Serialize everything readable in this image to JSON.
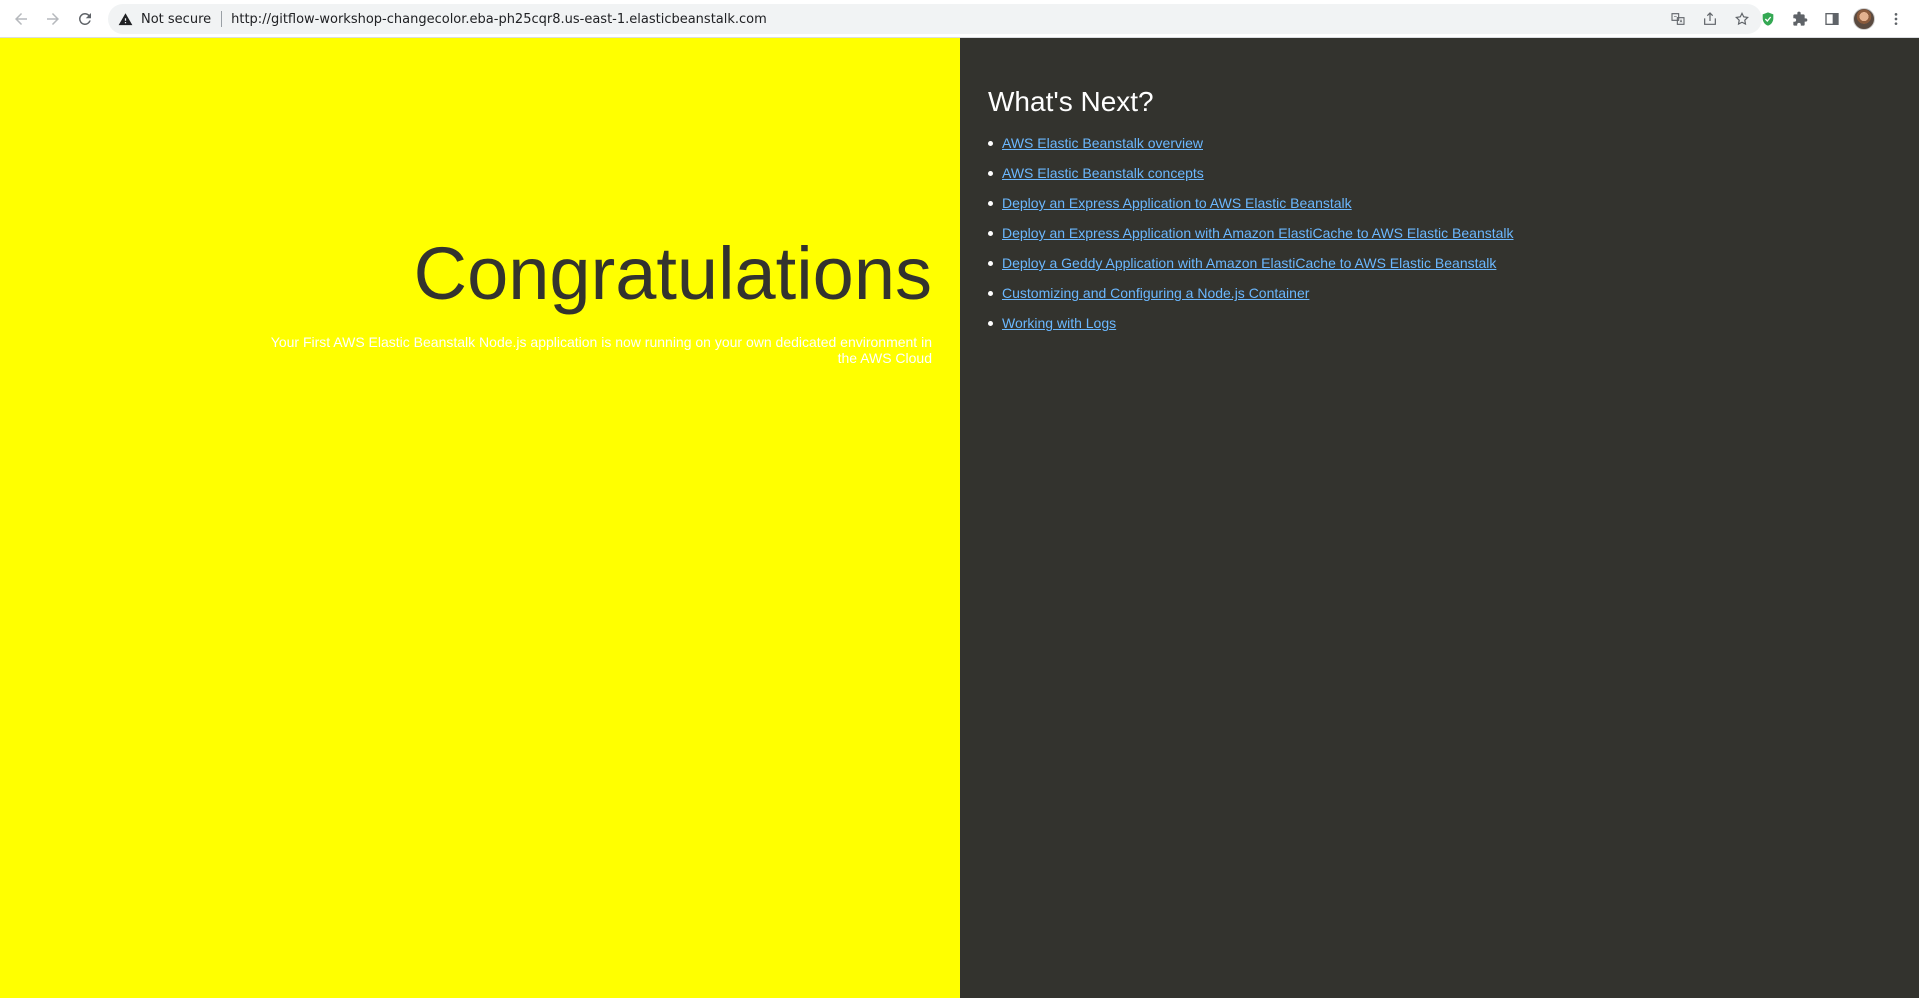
{
  "browser": {
    "security_label": "Not secure",
    "url": "http://gitflow-workshop-changecolor.eba-ph25cqr8.us-east-1.elasticbeanstalk.com",
    "icons": {
      "back": "back-arrow-icon",
      "forward": "forward-arrow-icon",
      "reload": "reload-icon",
      "security": "warning-triangle-icon",
      "translate": "translate-icon",
      "share": "share-icon",
      "bookmark": "star-icon",
      "extension_shield": "shield-check-icon",
      "extensions": "puzzle-icon",
      "side_panel": "side-panel-icon",
      "profile": "avatar",
      "menu": "more-vertical-icon"
    }
  },
  "page": {
    "colors": {
      "left_background": "#ffff00",
      "right_background": "#33332e",
      "link": "#6bb8ff",
      "headline": "#33332e"
    },
    "headline": "Congratulations",
    "subtext": "Your First AWS Elastic Beanstalk Node.js application is now running on your own dedicated environment in the AWS Cloud",
    "whats_next_title": "What's Next?",
    "links": [
      "AWS Elastic Beanstalk overview",
      "AWS Elastic Beanstalk concepts",
      "Deploy an Express Application to AWS Elastic Beanstalk",
      "Deploy an Express Application with Amazon ElastiCache to AWS Elastic Beanstalk",
      "Deploy a Geddy Application with Amazon ElastiCache to AWS Elastic Beanstalk",
      "Customizing and Configuring a Node.js Container",
      "Working with Logs"
    ]
  }
}
